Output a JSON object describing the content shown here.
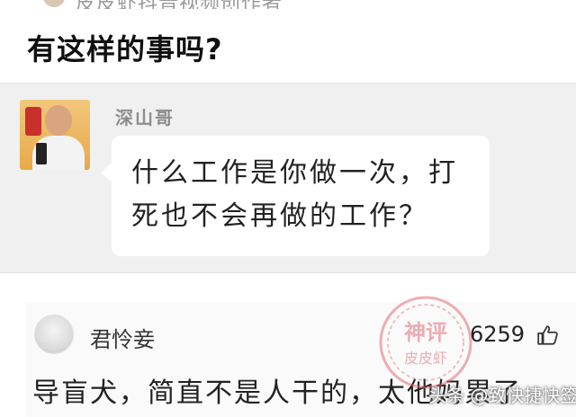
{
  "author_bar": {
    "text": "皮皮虾抖音视频创作者"
  },
  "post": {
    "title": "有这样的事吗?"
  },
  "quoted": {
    "username": "深山哥",
    "message": "什么工作是你做一次，打死也不会再做的工作？"
  },
  "comment": {
    "username": "君怜妾",
    "likes": "6259",
    "text": "导盲犬，简直不是人干的，太他妈累了"
  },
  "stamp": {
    "line1": "神评",
    "line2": "皮皮虾"
  },
  "watermark": {
    "text": "头条 @致快捷快签收"
  },
  "icons": {
    "like": "thumbs-up-icon"
  },
  "colors": {
    "stamp": "#e0606a",
    "quote_bg": "#f0f0f0"
  }
}
